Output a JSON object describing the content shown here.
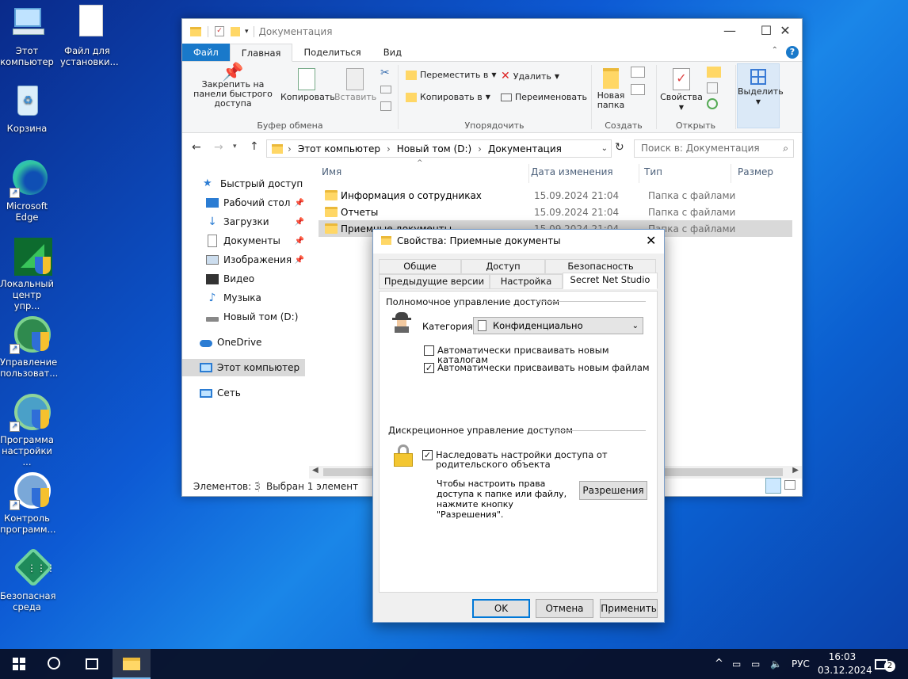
{
  "desktop": {
    "icons": [
      {
        "label": "Этот компьютер",
        "icon": "computer-icon"
      },
      {
        "label": "Файл для установки...",
        "icon": "file-icon"
      },
      {
        "label": "Корзина",
        "icon": "recycle-bin-icon"
      },
      {
        "label": "Microsoft Edge",
        "icon": "edge-icon"
      },
      {
        "label": "Локальный центр упр...",
        "icon": "local-management-icon"
      },
      {
        "label": "Управление пользоват...",
        "icon": "user-management-icon"
      },
      {
        "label": "Программа настройки ...",
        "icon": "settings-program-icon"
      },
      {
        "label": "Контроль программ...",
        "icon": "program-control-icon"
      },
      {
        "label": "Безопасная среда",
        "icon": "secure-environment-icon"
      }
    ]
  },
  "explorer": {
    "title": "Документация",
    "tabs": {
      "file": "Файл",
      "home": "Главная",
      "share": "Поделиться",
      "view": "Вид"
    },
    "ribbon": {
      "pin": "Закрепить на панели быстрого доступа",
      "copy": "Копировать",
      "paste": "Вставить",
      "clipboard_group": "Буфер обмена",
      "move_to": "Переместить в",
      "copy_to": "Копировать в",
      "delete": "Удалить",
      "rename": "Переименовать",
      "organize_group": "Упорядочить",
      "new_folder": "Новая папка",
      "create_group": "Создать",
      "properties": "Свойства",
      "open_group": "Открыть",
      "select": "Выделить"
    },
    "address": {
      "parts": [
        "Этот компьютер",
        "Новый том (D:)",
        "Документация"
      ],
      "search_placeholder": "Поиск в: Документация"
    },
    "nav": {
      "quick_access": "Быстрый доступ",
      "desktop": "Рабочий стол",
      "downloads": "Загрузки",
      "documents": "Документы",
      "pictures": "Изображения",
      "video": "Видео",
      "music": "Музыка",
      "drive": "Новый том (D:)",
      "onedrive": "OneDrive",
      "this_pc": "Этот компьютер",
      "network": "Сеть"
    },
    "columns": {
      "name": "Имя",
      "date": "Дата изменения",
      "type": "Тип",
      "size": "Размер"
    },
    "rows": [
      {
        "name": "Информация о сотрудниках",
        "date": "15.09.2024 21:04",
        "type": "Папка с файлами"
      },
      {
        "name": "Отчеты",
        "date": "15.09.2024 21:04",
        "type": "Папка с файлами"
      },
      {
        "name": "Приемные документы",
        "date": "15.09.2024 21:04",
        "type": "Папка с файлами"
      }
    ],
    "status": {
      "items": "Элементов: 3",
      "selected": "Выбран 1 элемент"
    }
  },
  "dialog": {
    "title": "Свойства: Приемные документы",
    "tabs": [
      "Общие",
      "Доступ",
      "Безопасность",
      "Предыдущие версии",
      "Настройка",
      "Secret Net Studio"
    ],
    "mandatory_header": "Полномочное управление доступом",
    "category_label": "Категория:",
    "category_value": "Конфиденциально",
    "auto_catalogs": "Автоматически присваивать новым каталогам",
    "auto_catalogs_checked": false,
    "auto_files": "Автоматически присваивать новым файлам",
    "auto_files_checked": true,
    "discretionary_header": "Дискреционное управление доступом",
    "inherit": "Наследовать настройки доступа от родительского объекта",
    "inherit_checked": true,
    "hint": "Чтобы настроить права доступа к папке или файлу, нажмите кнопку \"Разрешения\".",
    "permissions_btn": "Разрешения",
    "ok": "OK",
    "cancel": "Отмена",
    "apply": "Применить"
  },
  "taskbar": {
    "lang": "РУС",
    "time": "16:03",
    "date": "03.12.2024",
    "notifications": "2"
  }
}
